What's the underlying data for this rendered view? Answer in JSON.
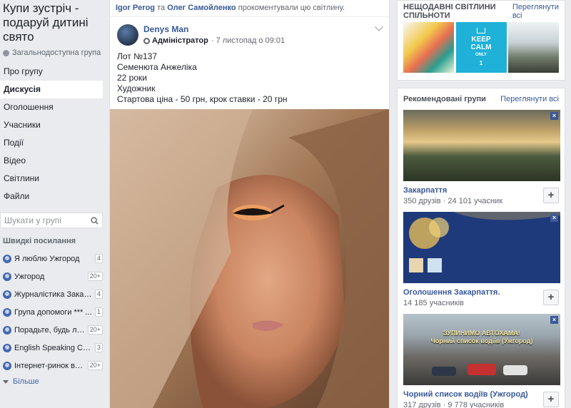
{
  "left": {
    "group_title": "Купи зустріч - подаруй дитині свято",
    "group_type": "Загальнодоступна група",
    "nav": [
      "Про групу",
      "Дискусія",
      "Оголошення",
      "Учасники",
      "Події",
      "Відео",
      "Світлини",
      "Файли"
    ],
    "active_nav": 1,
    "search_placeholder": "Шукати у групі",
    "quick_title": "Швидкі посилання",
    "quick_links": [
      {
        "label": "Я люблю Ужгород",
        "badge": "4"
      },
      {
        "label": "Ужгород",
        "badge": "20+"
      },
      {
        "label": "Журналістика Закар...",
        "badge": "4"
      },
      {
        "label": "Група допомоги *** ...",
        "badge": "1"
      },
      {
        "label": "Порадьте, будь ла...",
        "badge": "20+"
      },
      {
        "label": "English Speaking Club",
        "badge": "3"
      },
      {
        "label": "Інтернет-ринок в У...",
        "badge": "20+"
      }
    ],
    "more_label": "Більше"
  },
  "feed": {
    "activity": {
      "user1": "Igor Perog",
      "joiner": "та",
      "user2": "Олег Самойленко",
      "action": "прокоментували цю світлину."
    },
    "post": {
      "author": "Denys Man",
      "role": "Адміністратор",
      "date": "· 7 листопад о 09:01",
      "lines": [
        "Лот №137",
        "Семенюта Анжеліка",
        "22 роки",
        "Художник",
        "Стартова ціна - 50 грн, крок ставки - 20 грн"
      ]
    }
  },
  "right": {
    "photos_card": {
      "title": "НЕЩОДАВНІ СВІТЛИНИ СПІЛЬНОТИ",
      "link": "Переглянути всі",
      "keep_calm": [
        "KEEP",
        "CALM",
        "ONLY",
        "1"
      ]
    },
    "groups_card": {
      "title": "Рекомендовані групи",
      "link": "Переглянути всі",
      "groups": [
        {
          "name": "Закарпаття",
          "sub": "350 друзів · 24 101 учасник"
        },
        {
          "name": "Оголошення Закарпаття.",
          "sub": "14 185 учасників"
        },
        {
          "name": "Чорний список водіїв (Ужгород)",
          "sub": "317 друзів · 9 778 учасників",
          "overlay_line1": "ЗУПИНИМО АВТОХАМА!",
          "overlay_line2": "Чорний список водіїв (Ужгород)"
        }
      ]
    }
  },
  "colors": {
    "link": "#385898",
    "brand": "#4267b2",
    "background": "#e9ebee"
  }
}
